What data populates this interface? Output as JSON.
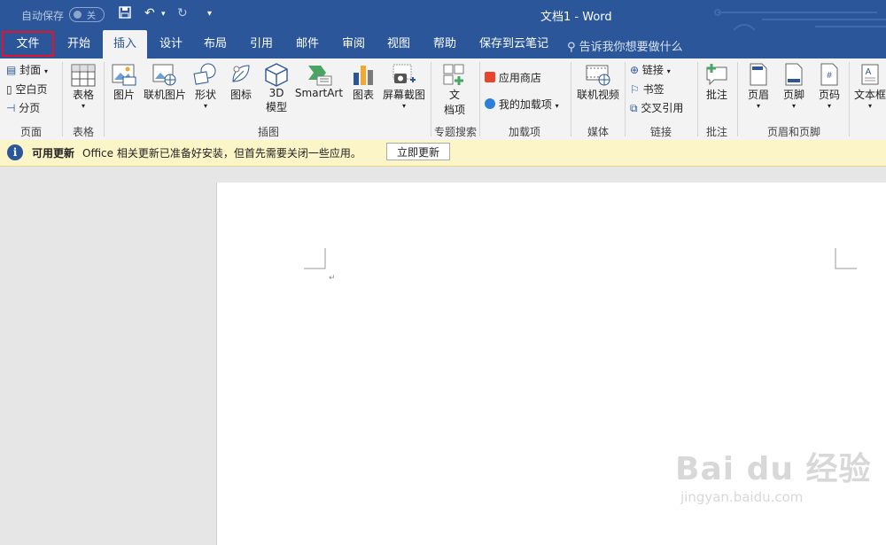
{
  "titlebar": {
    "autosave_label": "自动保存",
    "autosave_state": "关",
    "title": "文档1  -  Word"
  },
  "tabs": [
    {
      "label": "文件"
    },
    {
      "label": "开始"
    },
    {
      "label": "插入",
      "active": true
    },
    {
      "label": "设计"
    },
    {
      "label": "布局"
    },
    {
      "label": "引用"
    },
    {
      "label": "邮件"
    },
    {
      "label": "审阅"
    },
    {
      "label": "视图"
    },
    {
      "label": "帮助"
    },
    {
      "label": "保存到云笔记"
    }
  ],
  "tellme": "告诉我你想要做什么",
  "ribbon": {
    "pages": {
      "cover": "封面",
      "blank": "空白页",
      "break": "分页",
      "group": "页面"
    },
    "tables": {
      "table": "表格",
      "group": "表格"
    },
    "illustrations": {
      "picture": "图片",
      "online_picture": "联机图片",
      "shapes": "形状",
      "icons": "图标",
      "model3d_line1": "3D",
      "model3d_line2": "模型",
      "smartart": "SmartArt",
      "chart": "图表",
      "screenshot": "屏幕截图",
      "group": "插图"
    },
    "search": {
      "doc_line1": "文",
      "doc_line2": "档项",
      "group": "专题搜索"
    },
    "addins": {
      "store": "应用商店",
      "my_addins": "我的加载项",
      "group": "加载项"
    },
    "media": {
      "online_video": "联机视频",
      "group": "媒体"
    },
    "links": {
      "link": "链接",
      "bookmark": "书签",
      "crossref": "交叉引用",
      "group": "链接"
    },
    "comments": {
      "comment": "批注",
      "group": "批注"
    },
    "header_footer": {
      "header": "页眉",
      "footer": "页脚",
      "page_number": "页码",
      "group": "页眉和页脚"
    },
    "text": {
      "textbox": "文本框"
    }
  },
  "infobar": {
    "title": "可用更新",
    "message": "Office 相关更新已准备好安装，但首先需要关闭一些应用。",
    "button": "立即更新"
  },
  "watermark": {
    "brand": "Bai du 经验",
    "url": "jingyan.baidu.com"
  },
  "colors": {
    "brand": "#2b579a",
    "highlight": "#e3142a",
    "infobar": "#fcf5c8"
  }
}
